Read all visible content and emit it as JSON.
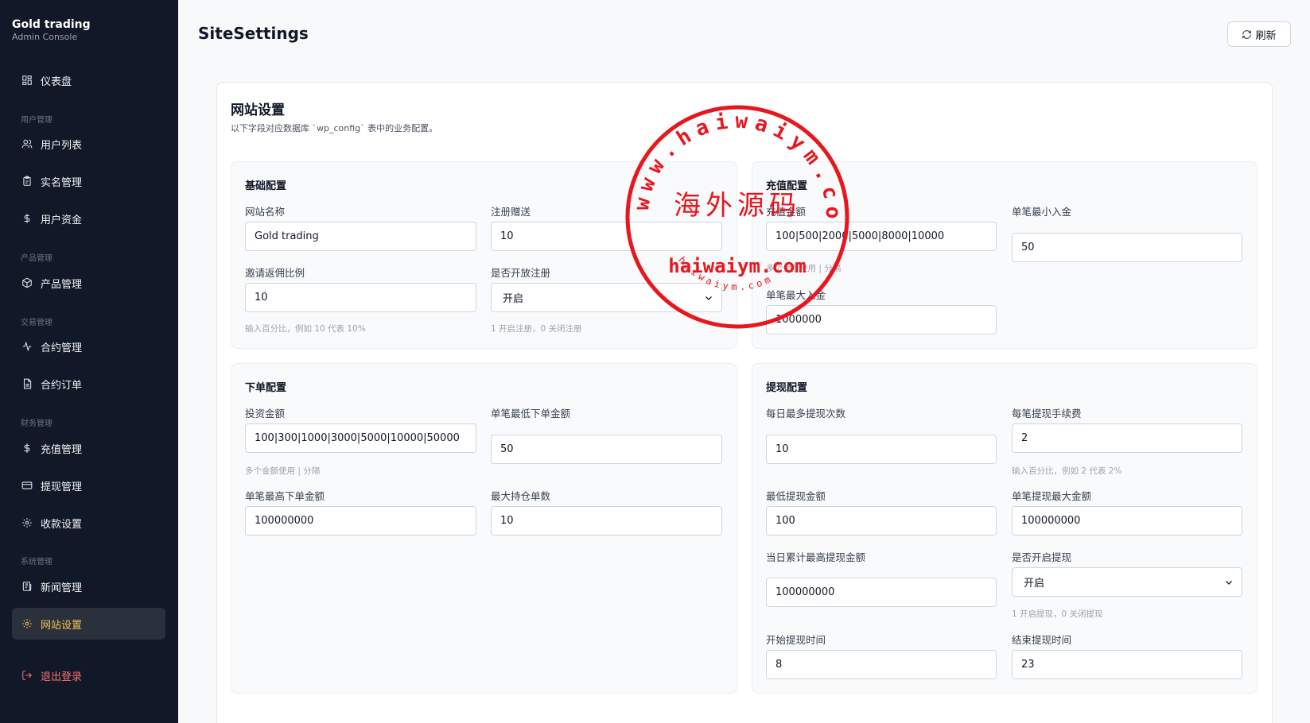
{
  "brand": {
    "title": "Gold trading",
    "subtitle": "Admin Console"
  },
  "nav": {
    "dashboard": "仪表盘",
    "group_user": "用户管理",
    "user_list": "用户列表",
    "realname": "实名管理",
    "user_funds": "用户资金",
    "group_product": "产品管理",
    "product_mgmt": "产品管理",
    "group_trade": "交易管理",
    "contract_mgmt": "合约管理",
    "contract_orders": "合约订单",
    "group_finance": "财务管理",
    "recharge_mgmt": "充值管理",
    "withdraw_mgmt": "提现管理",
    "payment_settings": "收款设置",
    "group_system": "系统管理",
    "news_mgmt": "新闻管理",
    "site_settings": "网站设置",
    "logout": "退出登录"
  },
  "header": {
    "title": "SiteSettings",
    "refresh_label": "刷新"
  },
  "card": {
    "title": "网站设置",
    "description": "以下字段对应数据库 `wp_config` 表中的业务配置。"
  },
  "basic": {
    "title": "基础配置",
    "site_name_label": "网站名称",
    "site_name_value": "Gold trading",
    "register_bonus_label": "注册赠送",
    "register_bonus_value": "10",
    "invite_ratio_label": "邀请返佣比例",
    "invite_ratio_value": "10",
    "invite_ratio_hint": "输入百分比，例如 10 代表 10%",
    "open_register_label": "是否开放注册",
    "open_register_value": "开启",
    "open_register_hint": "1 开启注册，0 关闭注册"
  },
  "recharge": {
    "title": "充值配置",
    "amounts_label": "充值金额",
    "amounts_value": "100|500|2000|5000|8000|10000",
    "amounts_hint": "多个金额使用 | 分隔",
    "min_label": "单笔最小入金",
    "min_value": "50",
    "max_label": "单笔最大入金",
    "max_value": "1000000"
  },
  "order": {
    "title": "下单配置",
    "invest_label": "投资金额",
    "invest_value": "100|300|1000|3000|5000|10000|50000",
    "invest_hint": "多个金额使用 | 分隔",
    "min_label": "单笔最低下单金额",
    "min_value": "50",
    "max_label": "单笔最高下单金额",
    "max_value": "100000000",
    "max_positions_label": "最大持仓单数",
    "max_positions_value": "10"
  },
  "withdraw": {
    "title": "提现配置",
    "daily_count_label": "每日最多提现次数",
    "daily_count_value": "10",
    "fee_label": "每笔提现手续费",
    "fee_value": "2",
    "fee_hint": "输入百分比，例如 2 代表 2%",
    "min_label": "最低提现金额",
    "min_value": "100",
    "max_label": "单笔提现最大金额",
    "max_value": "100000000",
    "daily_max_label": "当日累计最高提现金额",
    "daily_max_value": "100000000",
    "enable_label": "是否开启提现",
    "enable_value": "开启",
    "enable_hint": "1 开启提现，0 关闭提现",
    "start_label": "开始提现时间",
    "start_value": "8",
    "end_label": "结束提现时间",
    "end_value": "23"
  },
  "watermark": {
    "outer": "www.haiwaiym.com",
    "center_cn": "海外源码",
    "center_en": "haiwaiym.com",
    "inner": "haiwaiym.com",
    "color": "#e8161d"
  }
}
